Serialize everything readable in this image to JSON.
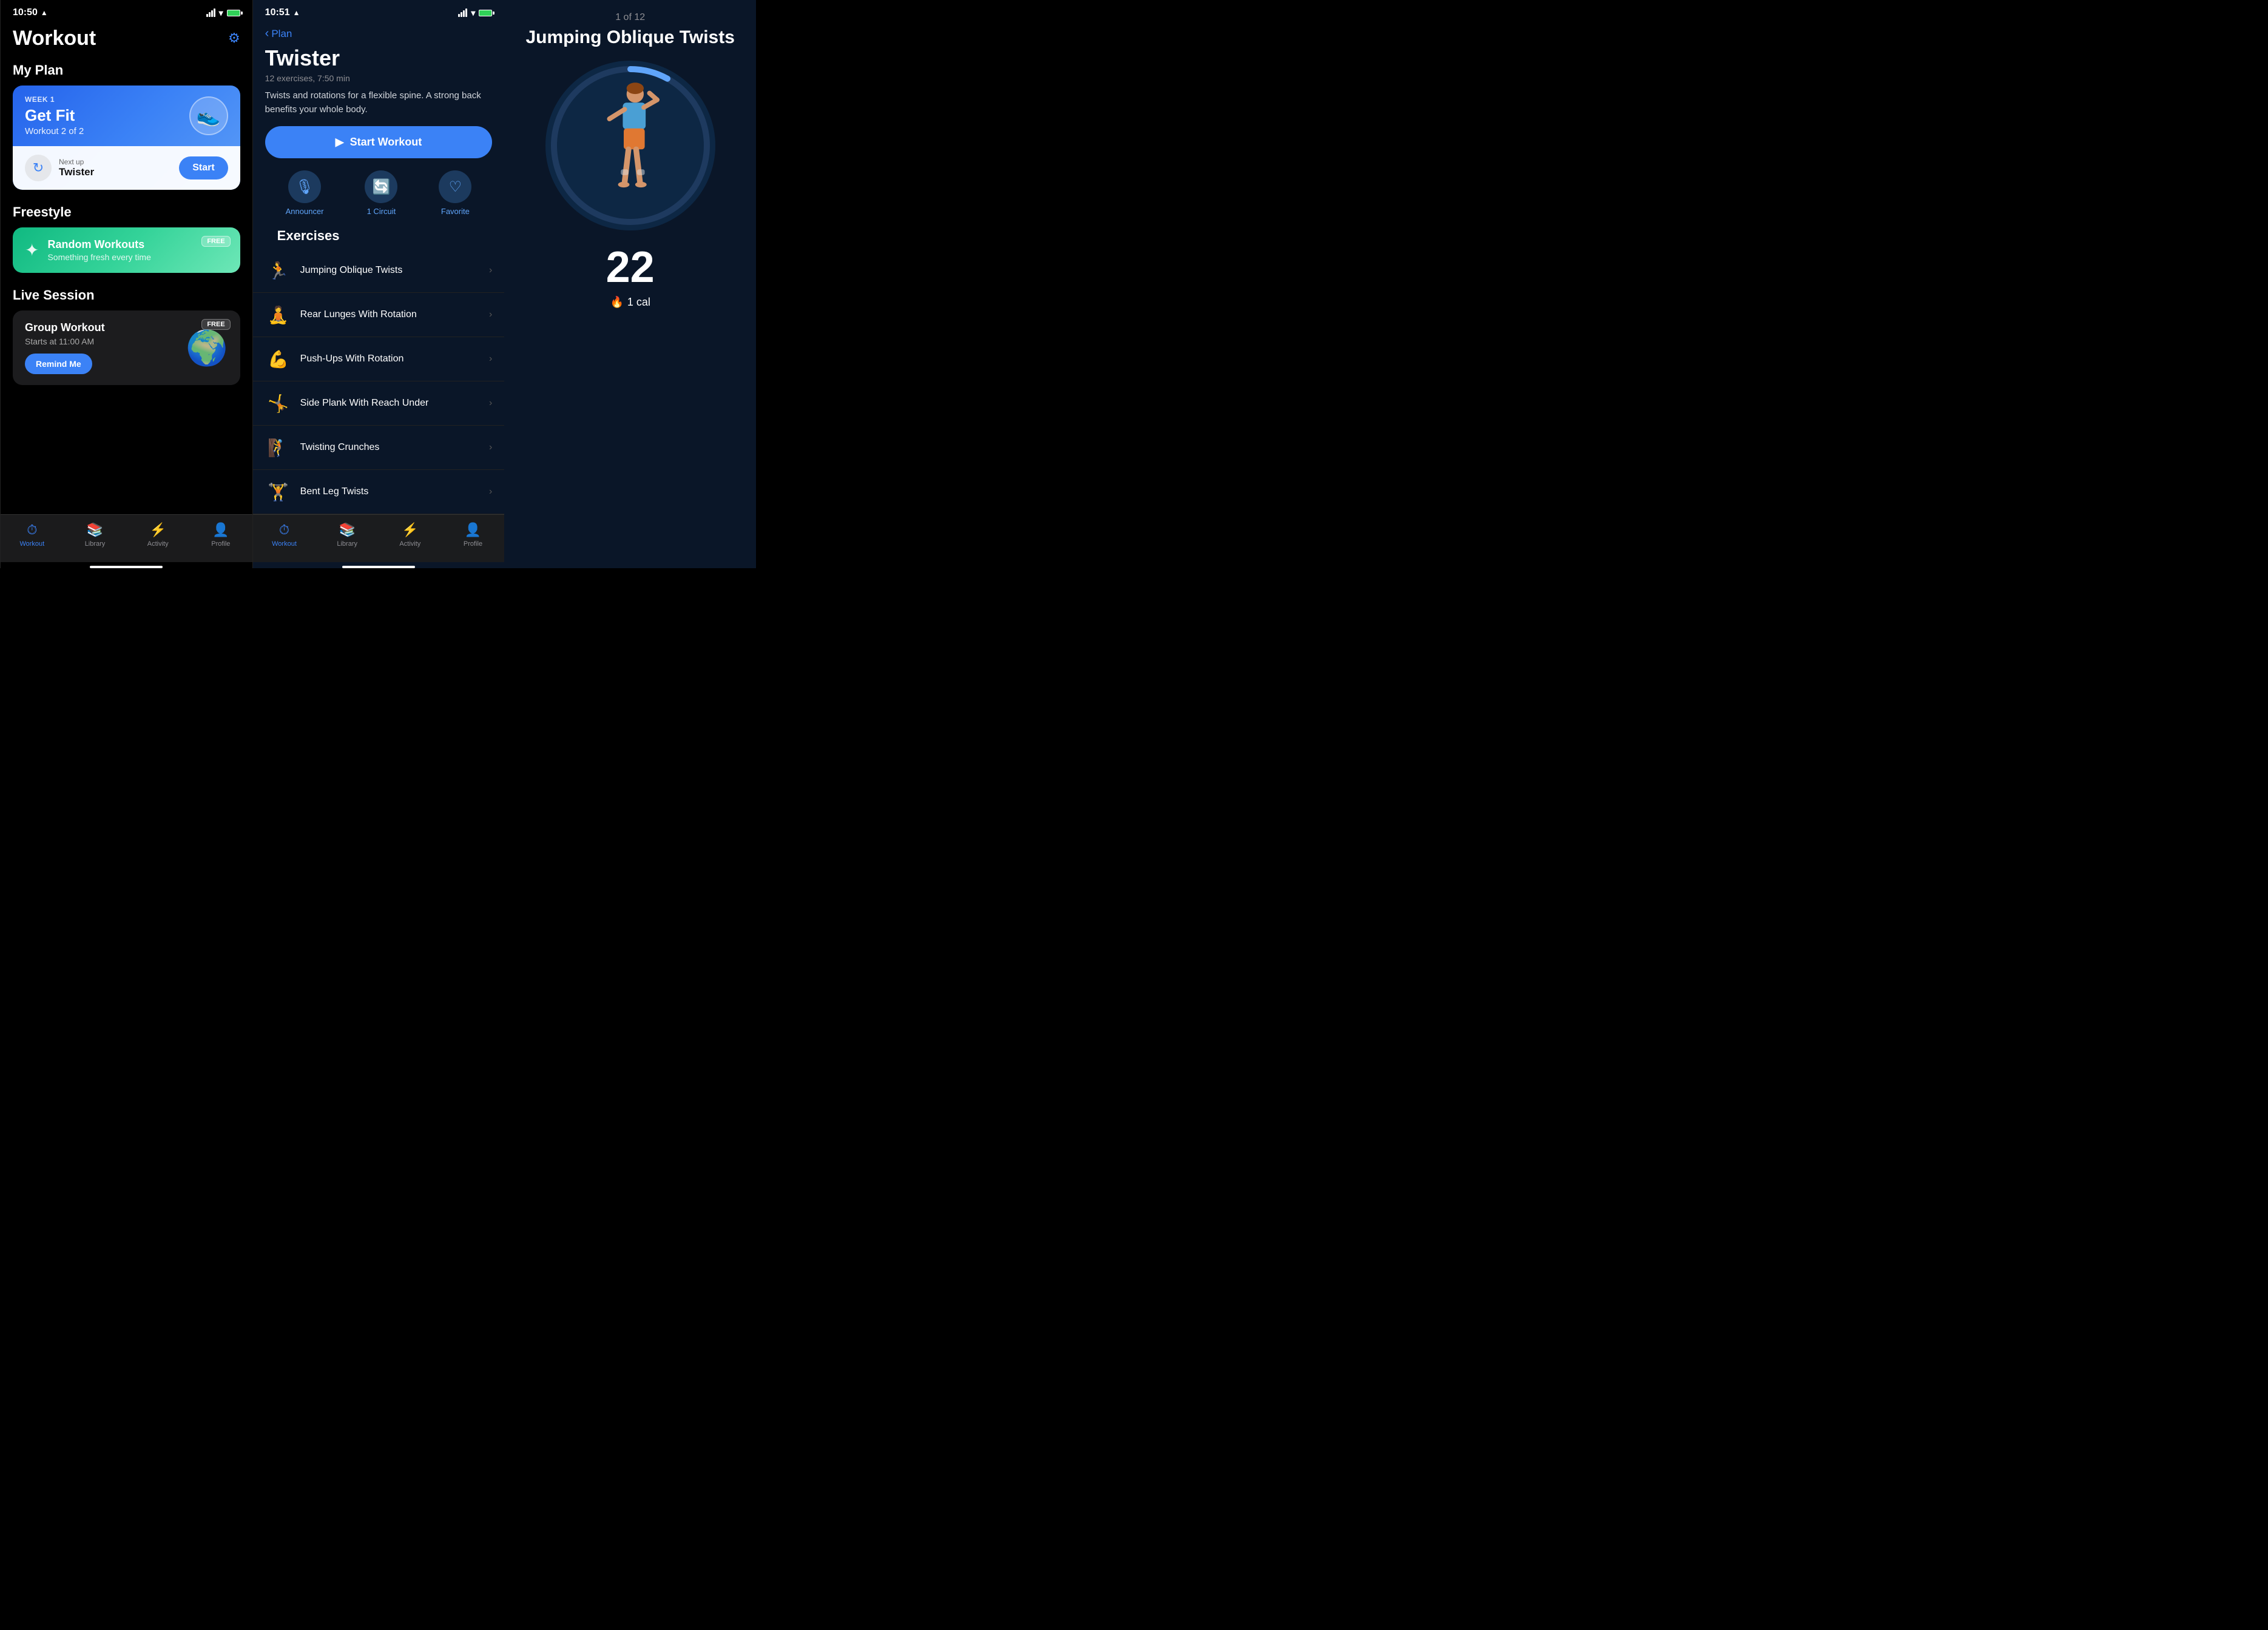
{
  "screen1": {
    "statusBar": {
      "time": "10:50",
      "locationArrow": "▲"
    },
    "title": "Workout",
    "gear": "⚙",
    "myPlan": {
      "sectionTitle": "My Plan",
      "card": {
        "weekLabel": "WEEK 1",
        "planName": "Get Fit",
        "planSub": "Workout 2 of 2",
        "shoeEmoji": "👟",
        "nextUpLabel": "Next up",
        "nextUpName": "Twister",
        "startLabel": "Start"
      }
    },
    "freestyle": {
      "sectionTitle": "Freestyle",
      "card": {
        "name": "Random Workouts",
        "sub": "Something fresh every time",
        "badge": "FREE"
      }
    },
    "liveSession": {
      "sectionTitle": "Live Session",
      "card": {
        "title": "Group Workout",
        "time": "Starts at 11:00 AM",
        "remindLabel": "Remind Me",
        "badge": "FREE",
        "globe": "🌍"
      }
    },
    "tabBar": {
      "items": [
        {
          "icon": "⏱",
          "label": "Workout",
          "active": true
        },
        {
          "icon": "📚",
          "label": "Library",
          "active": false
        },
        {
          "icon": "⚡",
          "label": "Activity",
          "active": false
        },
        {
          "icon": "👤",
          "label": "Profile",
          "active": false
        }
      ]
    }
  },
  "screen2": {
    "statusBar": {
      "time": "10:51"
    },
    "backLabel": "Plan",
    "title": "Twister",
    "meta": "12 exercises, 7:50 min",
    "description": "Twists and rotations for a flexible spine. A strong back benefits your whole body.",
    "startBtn": "Start Workout",
    "options": [
      {
        "icon": "🎙",
        "label": "Announcer"
      },
      {
        "icon": "🔄",
        "label": "1 Circuit"
      },
      {
        "icon": "♡",
        "label": "Favorite"
      }
    ],
    "exercisesTitle": "Exercises",
    "exercises": [
      {
        "name": "Jumping Oblique Twists",
        "figure": "🏃"
      },
      {
        "name": "Rear Lunges With Rotation",
        "figure": "🧘"
      },
      {
        "name": "Push-Ups With Rotation",
        "figure": "💪"
      },
      {
        "name": "Side Plank With Reach Under",
        "figure": "🤸"
      },
      {
        "name": "Twisting Crunches",
        "figure": "🧗"
      },
      {
        "name": "Bent Leg Twists",
        "figure": "🏋"
      }
    ],
    "tabBar": {
      "items": [
        {
          "icon": "⏱",
          "label": "Workout",
          "active": true
        },
        {
          "icon": "📚",
          "label": "Library",
          "active": false
        },
        {
          "icon": "⚡",
          "label": "Activity",
          "active": false
        },
        {
          "icon": "👤",
          "label": "Profile",
          "active": false
        }
      ]
    }
  },
  "screen3": {
    "counter": "1 of 12",
    "exerciseTitle": "Jumping Oblique Twists",
    "reps": "22",
    "calories": "1 cal",
    "progressPercent": 8,
    "circleColor": "#60a5fa",
    "circleTrackColor": "#1e3a5f"
  }
}
